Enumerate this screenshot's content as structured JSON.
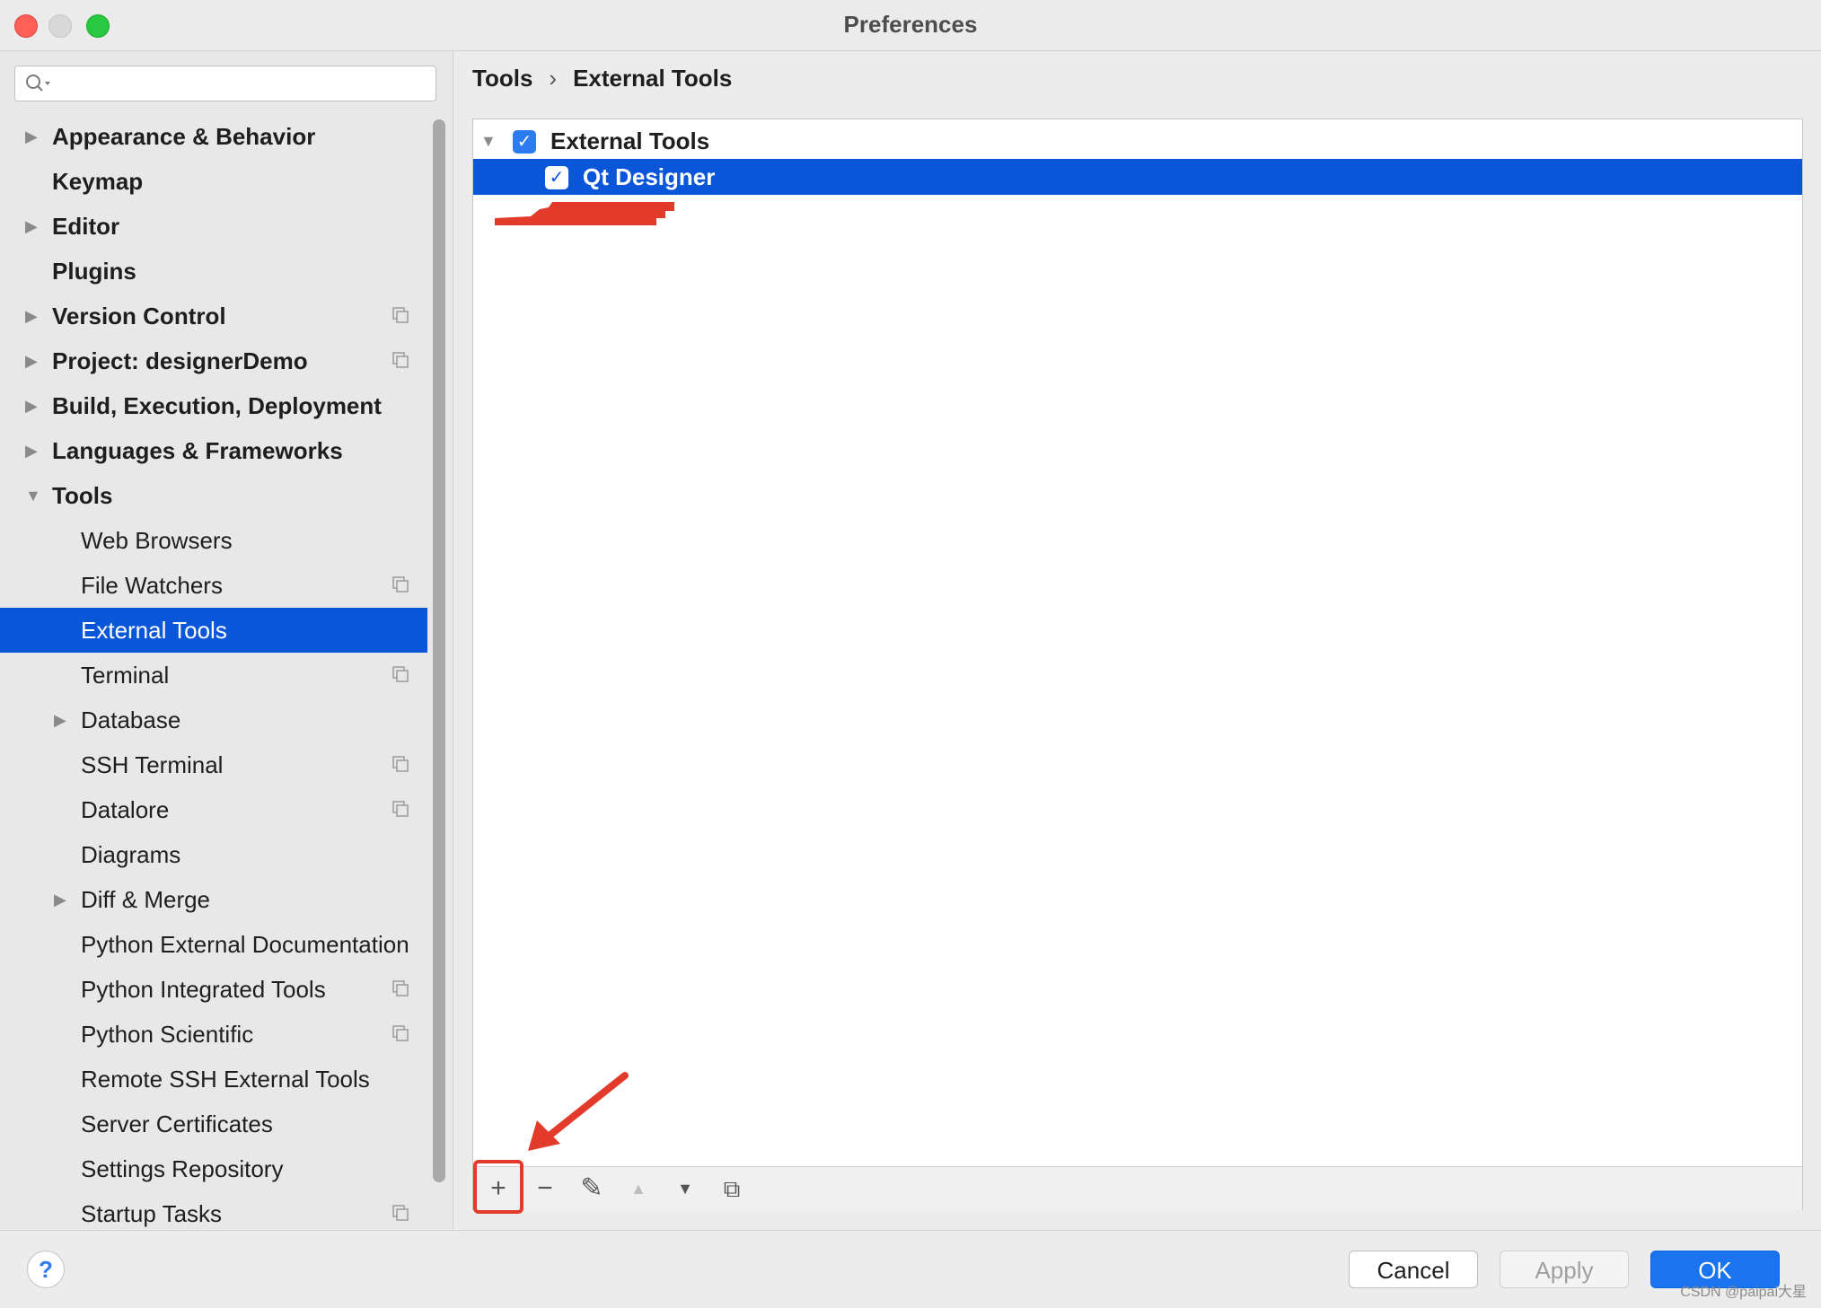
{
  "window": {
    "title": "Preferences"
  },
  "search": {
    "placeholder": ""
  },
  "sidebar": {
    "items": [
      {
        "label": "Appearance & Behavior",
        "level": 0,
        "expandable": true,
        "expanded": false,
        "project_icon": false
      },
      {
        "label": "Keymap",
        "level": 0,
        "expandable": false,
        "project_icon": false
      },
      {
        "label": "Editor",
        "level": 0,
        "expandable": true,
        "expanded": false,
        "project_icon": false
      },
      {
        "label": "Plugins",
        "level": 0,
        "expandable": false,
        "project_icon": false
      },
      {
        "label": "Version Control",
        "level": 0,
        "expandable": true,
        "expanded": false,
        "project_icon": true
      },
      {
        "label": "Project: designerDemo",
        "level": 0,
        "expandable": true,
        "expanded": false,
        "project_icon": true
      },
      {
        "label": "Build, Execution, Deployment",
        "level": 0,
        "expandable": true,
        "expanded": false,
        "project_icon": false
      },
      {
        "label": "Languages & Frameworks",
        "level": 0,
        "expandable": true,
        "expanded": false,
        "project_icon": false
      },
      {
        "label": "Tools",
        "level": 0,
        "expandable": true,
        "expanded": true,
        "project_icon": false
      },
      {
        "label": "Web Browsers",
        "level": 1,
        "expandable": false,
        "project_icon": false
      },
      {
        "label": "File Watchers",
        "level": 1,
        "expandable": false,
        "project_icon": true
      },
      {
        "label": "External Tools",
        "level": 1,
        "expandable": false,
        "project_icon": false,
        "selected": true
      },
      {
        "label": "Terminal",
        "level": 1,
        "expandable": false,
        "project_icon": true
      },
      {
        "label": "Database",
        "level": 1,
        "expandable": true,
        "expanded": false,
        "project_icon": false
      },
      {
        "label": "SSH Terminal",
        "level": 1,
        "expandable": false,
        "project_icon": true
      },
      {
        "label": "Datalore",
        "level": 1,
        "expandable": false,
        "project_icon": true
      },
      {
        "label": "Diagrams",
        "level": 1,
        "expandable": false,
        "project_icon": false
      },
      {
        "label": "Diff & Merge",
        "level": 1,
        "expandable": true,
        "expanded": false,
        "project_icon": false
      },
      {
        "label": "Python External Documentation",
        "level": 1,
        "expandable": false,
        "project_icon": false
      },
      {
        "label": "Python Integrated Tools",
        "level": 1,
        "expandable": false,
        "project_icon": true
      },
      {
        "label": "Python Scientific",
        "level": 1,
        "expandable": false,
        "project_icon": true
      },
      {
        "label": "Remote SSH External Tools",
        "level": 1,
        "expandable": false,
        "project_icon": false
      },
      {
        "label": "Server Certificates",
        "level": 1,
        "expandable": false,
        "project_icon": false
      },
      {
        "label": "Settings Repository",
        "level": 1,
        "expandable": false,
        "project_icon": false
      },
      {
        "label": "Startup Tasks",
        "level": 1,
        "expandable": false,
        "project_icon": true
      }
    ]
  },
  "breadcrumb": {
    "parent": "Tools",
    "separator": "›",
    "current": "External Tools"
  },
  "tools_tree": {
    "group": {
      "label": "External Tools",
      "checked": true,
      "expanded": true
    },
    "children": [
      {
        "label": "Qt Designer",
        "checked": true,
        "selected": true
      }
    ]
  },
  "toolbar": {
    "buttons": [
      {
        "name": "add",
        "icon": "plus-icon",
        "glyph": "+",
        "enabled": true,
        "highlighted": true
      },
      {
        "name": "remove",
        "icon": "minus-icon",
        "glyph": "−",
        "enabled": true
      },
      {
        "name": "edit",
        "icon": "pencil-icon",
        "glyph": "✎",
        "enabled": true
      },
      {
        "name": "move-up",
        "icon": "triangle-up-icon",
        "glyph": "▲",
        "enabled": false
      },
      {
        "name": "move-down",
        "icon": "triangle-down-icon",
        "glyph": "▼",
        "enabled": true
      },
      {
        "name": "copy",
        "icon": "copy-icon",
        "glyph": "⧉",
        "enabled": true
      }
    ]
  },
  "footer": {
    "help_label": "?",
    "cancel_label": "Cancel",
    "apply_label": "Apply",
    "ok_label": "OK",
    "watermark": "CSDN @paipai大星"
  },
  "colors": {
    "selection": "#0a56d8",
    "checkbox": "#2d7bf0",
    "annotation_red": "#e23a2b",
    "ok_button": "#1a74f0"
  }
}
